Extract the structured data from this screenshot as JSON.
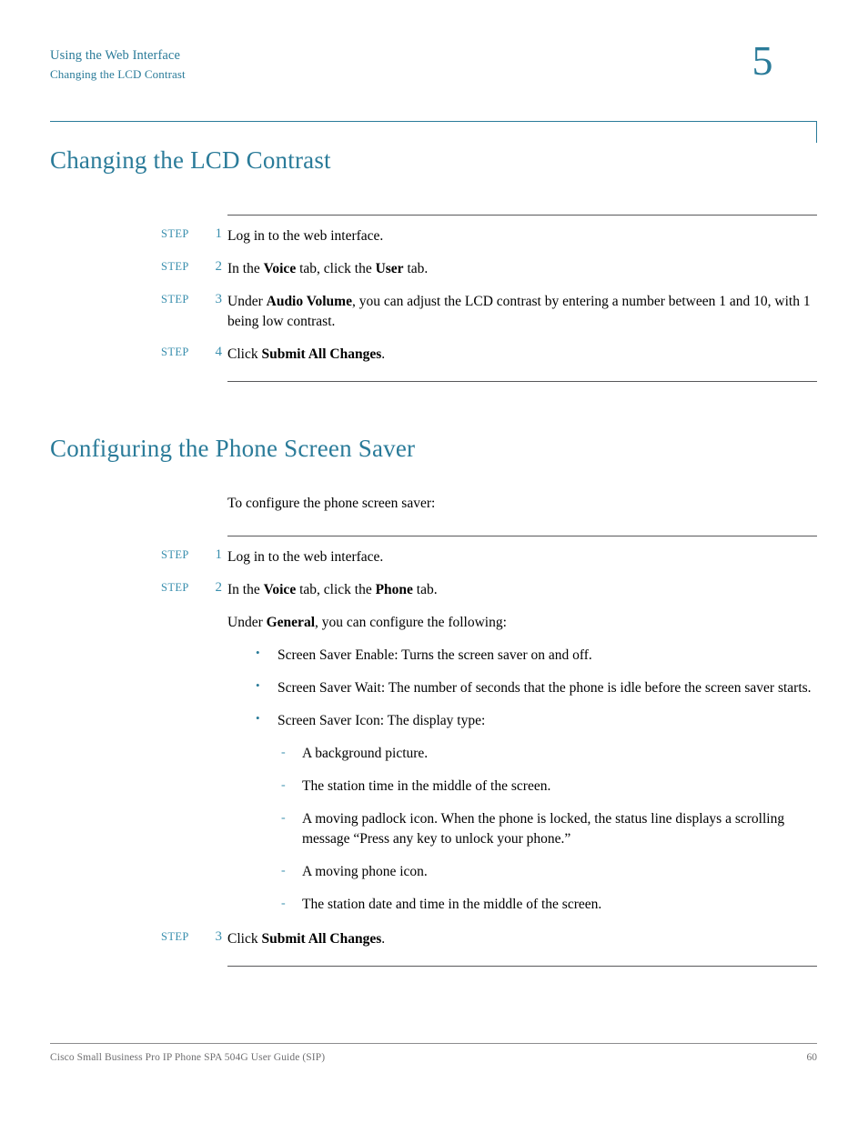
{
  "header": {
    "line1": "Using the Web Interface",
    "line2": "Changing the LCD Contrast",
    "chapter_number": "5"
  },
  "colors": {
    "heading_teal": "#2a7b99",
    "step_label_teal": "#3a8fae",
    "rule_gray": "#58585a",
    "footer_gray": "#6f6f71",
    "body_black": "#000000"
  },
  "section_lcd": {
    "title": "Changing the LCD Contrast",
    "step_label": "STEP",
    "steps": [
      {
        "number": "1",
        "parts": [
          {
            "text": "Log in to the web interface.",
            "bold": false
          }
        ]
      },
      {
        "number": "2",
        "parts": [
          {
            "text": "In the ",
            "bold": false
          },
          {
            "text": "Voice",
            "bold": true
          },
          {
            "text": " tab, click the ",
            "bold": false
          },
          {
            "text": "User",
            "bold": true
          },
          {
            "text": " tab.",
            "bold": false
          }
        ]
      },
      {
        "number": "3",
        "parts": [
          {
            "text": "Under ",
            "bold": false
          },
          {
            "text": "Audio Volume",
            "bold": true
          },
          {
            "text": ", you can adjust the LCD contrast by entering a number between 1 and 10, with 1 being low contrast.",
            "bold": false
          }
        ]
      },
      {
        "number": "4",
        "parts": [
          {
            "text": "Click ",
            "bold": false
          },
          {
            "text": "Submit All Changes",
            "bold": true
          },
          {
            "text": ".",
            "bold": false
          }
        ]
      }
    ]
  },
  "section_saver": {
    "title": "Configuring the Phone Screen Saver",
    "intro": "To configure the phone screen saver:",
    "step_label": "STEP",
    "steps": [
      {
        "number": "1",
        "parts": [
          {
            "text": "Log in to the web interface.",
            "bold": false
          }
        ]
      },
      {
        "number": "2",
        "parts": [
          {
            "text": "In the ",
            "bold": false
          },
          {
            "text": "Voice",
            "bold": true
          },
          {
            "text": " tab, click the ",
            "bold": false
          },
          {
            "text": "Phone",
            "bold": true
          },
          {
            "text": " tab.",
            "bold": false
          }
        ]
      },
      {
        "number": "3",
        "parts": [
          {
            "text": "Click ",
            "bold": false
          },
          {
            "text": "Submit All Changes",
            "bold": true
          },
          {
            "text": ".",
            "bold": false
          }
        ]
      }
    ],
    "under_general": [
      {
        "text": "Under ",
        "bold": false
      },
      {
        "text": "General",
        "bold": true
      },
      {
        "text": ", you can configure the following:",
        "bold": false
      }
    ],
    "bullets": [
      "Screen Saver Enable: Turns the screen saver on and off.",
      "Screen Saver Wait: The number of seconds that the phone is idle before the screen saver starts.",
      "Screen Saver Icon: The display type:"
    ],
    "sub_items": [
      "A background picture.",
      "The station time in the middle of the screen.",
      "A moving padlock icon. When the phone is locked, the status line displays a scrolling message “Press any key to unlock your phone.”",
      "A moving phone icon.",
      "The station date and time in the middle of the screen."
    ]
  },
  "footer": {
    "left": "Cisco Small Business Pro IP Phone SPA 504G User Guide (SIP)",
    "page_number": "60"
  }
}
